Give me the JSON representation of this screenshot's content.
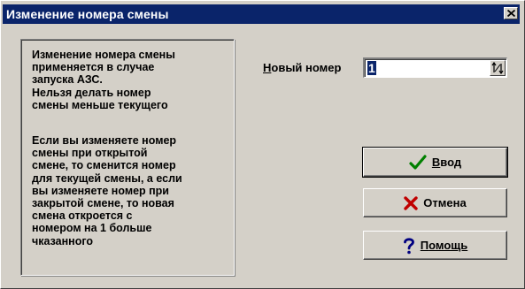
{
  "window": {
    "title": "Изменение номера смены",
    "close_glyph": "×"
  },
  "info": {
    "paragraph_1": "Изменение номера смены\nприменяется в случае\nзапуска АЗС.\nНельзя делать номер\nсмены меньше текущего",
    "paragraph_2": "Если вы изменяете номер\nсмены при открытой\nсмене, то сменится номер\nдля текущей смены, а если\nвы изменяете номер при\nзакрытой смене, то новая\nсмена откроется с\nномером на 1 больше\nчказанного"
  },
  "new_number": {
    "label_accel": "Н",
    "label_rest": "овый номер",
    "value": "1"
  },
  "buttons": {
    "enter": {
      "accel": "В",
      "rest": "вод",
      "icon": "checkmark-icon",
      "icon_color": "#008000"
    },
    "cancel": {
      "label": "Отмена",
      "icon": "cross-icon",
      "icon_color": "#c00000"
    },
    "help": {
      "accel": "П",
      "rest": "омощь",
      "icon": "question-icon",
      "icon_color": "#000080"
    }
  },
  "colors": {
    "title_bar": "#0a246a",
    "face": "#d4d0c8",
    "selection": "#0a246a"
  }
}
